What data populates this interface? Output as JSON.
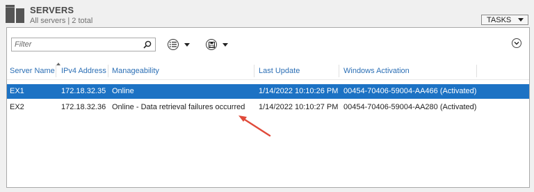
{
  "header": {
    "title": "SERVERS",
    "subtitle": "All servers | 2 total",
    "tasks_label": "TASKS"
  },
  "toolbar": {
    "filter_placeholder": "Filter",
    "search_icon": "search-icon",
    "list_view_icon": "list-icon",
    "save_icon": "save-icon",
    "expand_icon": "chevron-down-icon"
  },
  "table": {
    "columns": [
      "Server Name",
      "IPv4 Address",
      "Manageability",
      "Last Update",
      "Windows Activation"
    ],
    "rows": [
      {
        "name": "EX1",
        "ip": "172.18.32.35",
        "manageability": "Online",
        "last_update": "1/14/2022 10:10:26 PM",
        "activation": "00454-70406-59004-AA466 (Activated)",
        "selected": true
      },
      {
        "name": "EX2",
        "ip": "172.18.32.36",
        "manageability": "Online - Data retrieval failures occurred",
        "last_update": "1/14/2022 10:10:27 PM",
        "activation": "00454-70406-59004-AA280 (Activated)",
        "selected": false
      }
    ]
  },
  "colors": {
    "selection": "#1c72c4",
    "header_text": "#2c6fb5",
    "annotation_arrow": "#e04a3a"
  }
}
